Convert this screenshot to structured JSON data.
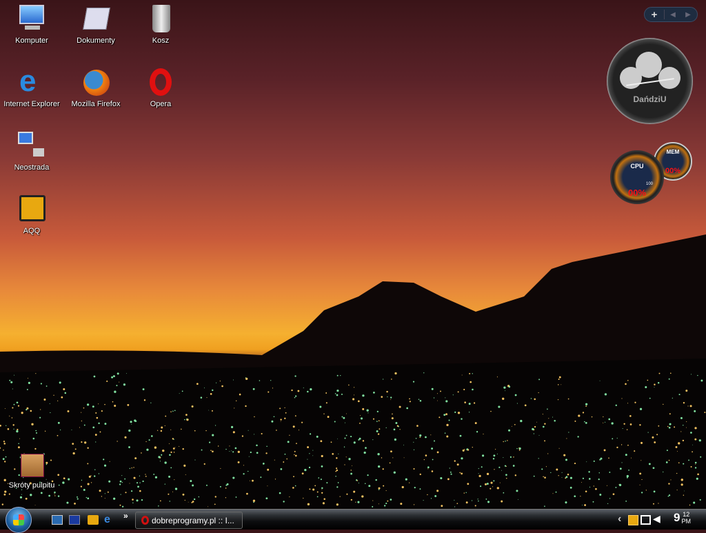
{
  "desktop": {
    "icons": [
      {
        "label": "Komputer",
        "icon": "computer-icon"
      },
      {
        "label": "Dokumenty",
        "icon": "documents-icon"
      },
      {
        "label": "Kosz",
        "icon": "recycle-bin-icon"
      },
      {
        "label": "Internet Explorer",
        "icon": "ie-icon"
      },
      {
        "label": "Mozilla Firefox",
        "icon": "firefox-icon"
      },
      {
        "label": "Opera",
        "icon": "opera-icon"
      },
      {
        "label": "Neostrada",
        "icon": "network-icon"
      },
      {
        "label": "AQQ",
        "icon": "aqq-icon"
      },
      {
        "label": "Skróty pulpitu",
        "icon": "box-icon"
      }
    ]
  },
  "gadgets": {
    "add": "+",
    "clock_brand": "DańdziU",
    "cpu": {
      "label": "CPU",
      "value": "00%",
      "max": "100"
    },
    "mem": {
      "label": "MEM",
      "value": "00%"
    }
  },
  "taskbar": {
    "task": "dobreprogramy.pl :: I...",
    "more": "»",
    "tray_expand": "‹",
    "time_hour": "9",
    "time_min": "12",
    "time_ampm": "PM"
  },
  "colors": {
    "accent": "#1a5a9a",
    "gauge_red": "#e01010"
  }
}
